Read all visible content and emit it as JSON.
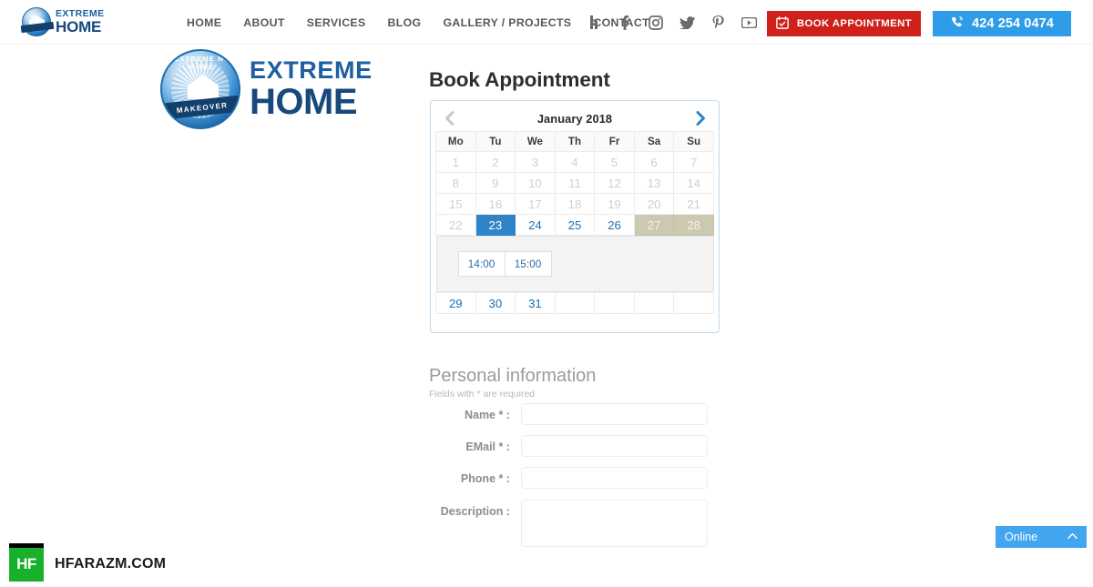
{
  "header": {
    "brand": {
      "line1": "EXTREME",
      "line2": "HOME",
      "logo_icon": "extreme-home-seal-logo"
    },
    "nav": [
      {
        "label": "HOME"
      },
      {
        "label": "ABOUT"
      },
      {
        "label": "SERVICES"
      },
      {
        "label": "BLOG"
      },
      {
        "label": "GALLERY / PROJECTS"
      },
      {
        "label": "CONTACT"
      }
    ],
    "social": [
      {
        "name": "houzz-icon"
      },
      {
        "name": "facebook-icon"
      },
      {
        "name": "instagram-icon"
      },
      {
        "name": "twitter-icon"
      },
      {
        "name": "pinterest-icon"
      },
      {
        "name": "youtube-icon"
      }
    ],
    "book_button": {
      "label": "BOOK APPOINTMENT",
      "icon": "calendar-check-icon",
      "color": "#d0201a"
    },
    "phone_button": {
      "label": "424 254 0474",
      "icon": "phone-ring-icon",
      "color": "#2e9ce8"
    }
  },
  "hero": {
    "logo_arc_text": "EXTREME ME HOME",
    "logo_ribbon_text": "MAKEOVER",
    "word1": "EXTREME",
    "word2": "HOME"
  },
  "main": {
    "page_title": "Book Appointment"
  },
  "calendar": {
    "title": "January 2018",
    "prev_label": "❮",
    "next_label": "❯",
    "weekdays": [
      "Mo",
      "Tu",
      "We",
      "Th",
      "Fr",
      "Sa",
      "Su"
    ],
    "selected_day": "23",
    "accent_selected": "#2f83c7",
    "weekend_color": "#cdc9b0",
    "link_color": "#1a6fb5",
    "weeks": [
      [
        {
          "d": "1",
          "s": "past"
        },
        {
          "d": "2",
          "s": "past"
        },
        {
          "d": "3",
          "s": "past"
        },
        {
          "d": "4",
          "s": "past"
        },
        {
          "d": "5",
          "s": "past"
        },
        {
          "d": "6",
          "s": "past"
        },
        {
          "d": "7",
          "s": "past"
        }
      ],
      [
        {
          "d": "8",
          "s": "past"
        },
        {
          "d": "9",
          "s": "past"
        },
        {
          "d": "10",
          "s": "past"
        },
        {
          "d": "11",
          "s": "past"
        },
        {
          "d": "12",
          "s": "past"
        },
        {
          "d": "13",
          "s": "past"
        },
        {
          "d": "14",
          "s": "past"
        }
      ],
      [
        {
          "d": "15",
          "s": "past"
        },
        {
          "d": "16",
          "s": "past"
        },
        {
          "d": "17",
          "s": "past"
        },
        {
          "d": "18",
          "s": "past"
        },
        {
          "d": "19",
          "s": "past"
        },
        {
          "d": "20",
          "s": "past"
        },
        {
          "d": "21",
          "s": "past"
        }
      ],
      [
        {
          "d": "22",
          "s": "past"
        },
        {
          "d": "23",
          "s": "sel"
        },
        {
          "d": "24",
          "s": "avail"
        },
        {
          "d": "25",
          "s": "avail"
        },
        {
          "d": "26",
          "s": "avail"
        },
        {
          "d": "27",
          "s": "weekend"
        },
        {
          "d": "28",
          "s": "weekend"
        }
      ],
      [
        {
          "d": "29",
          "s": "avail"
        },
        {
          "d": "30",
          "s": "avail"
        },
        {
          "d": "31",
          "s": "avail"
        },
        {
          "d": "",
          "s": "empty"
        },
        {
          "d": "",
          "s": "empty"
        },
        {
          "d": "",
          "s": "empty"
        },
        {
          "d": "",
          "s": "empty"
        }
      ]
    ],
    "time_slots": [
      "14:00",
      "15:00"
    ]
  },
  "form": {
    "section_title": "Personal information",
    "required_note": "Fields with * are required",
    "fields": [
      {
        "label": "Name * :",
        "value": "",
        "placeholder": "",
        "type": "text",
        "name": "name-field"
      },
      {
        "label": "EMail * :",
        "value": "",
        "placeholder": "",
        "type": "text",
        "name": "email-field"
      },
      {
        "label": "Phone * :",
        "value": "",
        "placeholder": "",
        "type": "text",
        "name": "phone-field"
      },
      {
        "label": "Description :",
        "value": "",
        "placeholder": "",
        "type": "textarea",
        "name": "description-field"
      }
    ]
  },
  "chat": {
    "label": "Online",
    "arrow": "⌃"
  },
  "watermark": {
    "badge": "HF",
    "text": "HFARAZM.COM",
    "badge_color": "#19b12c"
  }
}
